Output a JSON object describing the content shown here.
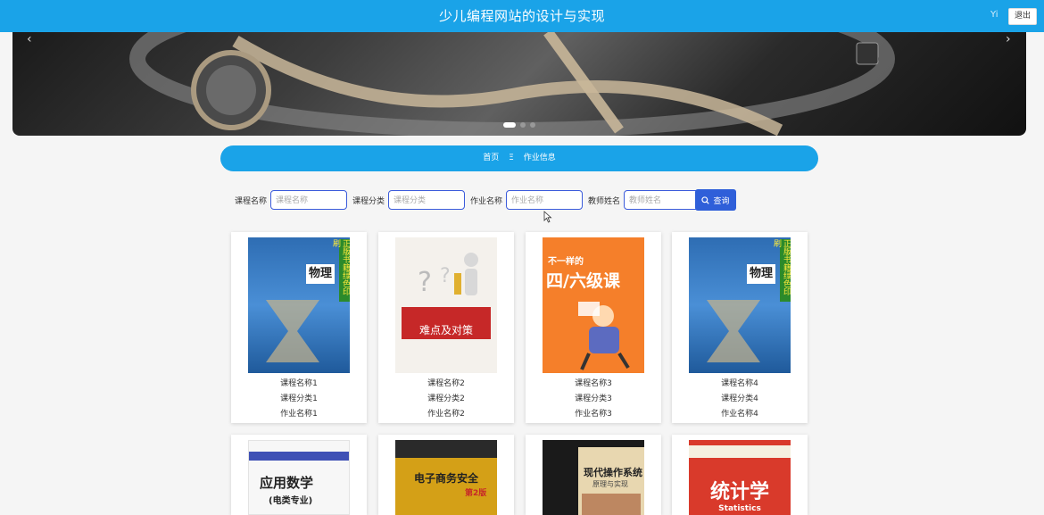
{
  "header": {
    "title": "少儿编程网站的设计与实现",
    "user_label": "Yi",
    "logout_label": "退出"
  },
  "banner": {
    "prev": "‹",
    "next": "›"
  },
  "breadcrumb": {
    "home": "首页",
    "separator": "Ξ",
    "current": "作业信息"
  },
  "search": {
    "course_name_label": "课程名称",
    "course_name_placeholder": "课程名称",
    "course_category_label": "课程分类",
    "course_category_placeholder": "课程分类",
    "homework_name_label": "作业名称",
    "homework_name_placeholder": "作业名称",
    "teacher_name_label": "教师姓名",
    "teacher_name_placeholder": "教师姓名",
    "query_label": "查询"
  },
  "cards": [
    {
      "course": "课程名称1",
      "category": "课程分类1",
      "homework": "作业名称1",
      "cover_text": "物理",
      "side_text": "正版书籍绿色印刷"
    },
    {
      "course": "课程名称2",
      "category": "课程分类2",
      "homework": "作业名称2",
      "cover_text": "难点及对策",
      "side_text": ""
    },
    {
      "course": "课程名称3",
      "category": "课程分类3",
      "homework": "作业名称3",
      "cover_text": "四/六级课",
      "side_text": "不一样的"
    },
    {
      "course": "课程名称4",
      "category": "课程分类4",
      "homework": "作业名称4",
      "cover_text": "物理",
      "side_text": "正版书籍绿色印刷"
    },
    {
      "cover_text": "应用数学",
      "side_text": "(电类专业)"
    },
    {
      "cover_text": "电子商务安全",
      "side_text": "第2版"
    },
    {
      "cover_text": "现代操作系统",
      "side_text": "原理与实现"
    },
    {
      "cover_text": "统计学",
      "side_text": "Statistics"
    }
  ]
}
